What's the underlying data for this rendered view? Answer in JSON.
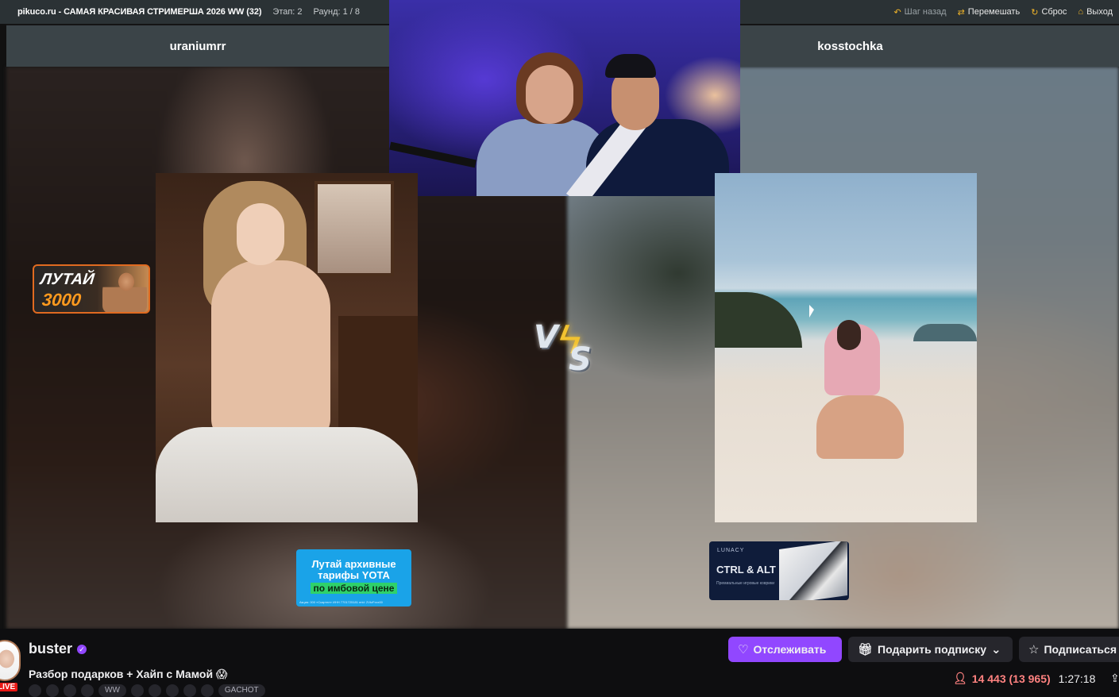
{
  "topbar": {
    "site_title": "pikuco.ru - САМАЯ КРАСИВАЯ СТРИМЕРША 2026 WW (32)",
    "stage": "Этап: 2",
    "round": "Раунд: 1 / 8",
    "actions": {
      "step_back": "Шаг назад",
      "shuffle": "Перемешать",
      "reset": "Сброс",
      "exit": "Выход"
    }
  },
  "contestants": {
    "left": "uraniumrr",
    "right": "kosstochka"
  },
  "versus": {
    "v": "V",
    "s": "S"
  },
  "ads": {
    "lutay": {
      "line1": "ЛУТАЙ",
      "line2": "3000"
    },
    "yota": {
      "line1": "Лутай архивные",
      "line2": "тарифы YOTA",
      "line3": "по имбовой цене",
      "fine": "Акция: 000 «Скартел» ИНН 7701725181 erid: 2VtzFxxx00"
    },
    "ctrl": {
      "brand": "LUNACY",
      "title": "CTRL & ALT",
      "sub": "Премиальные игровые коврики"
    }
  },
  "channel": {
    "name": "buster",
    "live_badge": "LIVE",
    "stream_title": "Разбор подарков + Хайп с Мамой 😱",
    "tags": [
      "",
      "",
      "",
      "",
      "WW",
      "",
      "",
      "",
      "",
      "",
      "GACHOT"
    ]
  },
  "buttons": {
    "follow": "Отслеживать",
    "gift_sub": "Подарить подписку",
    "subscribe": "Подписаться"
  },
  "stats": {
    "viewers": "14 443 (13 965)",
    "uptime": "1:27:18"
  },
  "colors": {
    "twitch_purple": "#9147ff",
    "viewer_red": "#ff8280",
    "topbar_bg": "#2b3235",
    "namebar_bg": "#3b4448"
  }
}
